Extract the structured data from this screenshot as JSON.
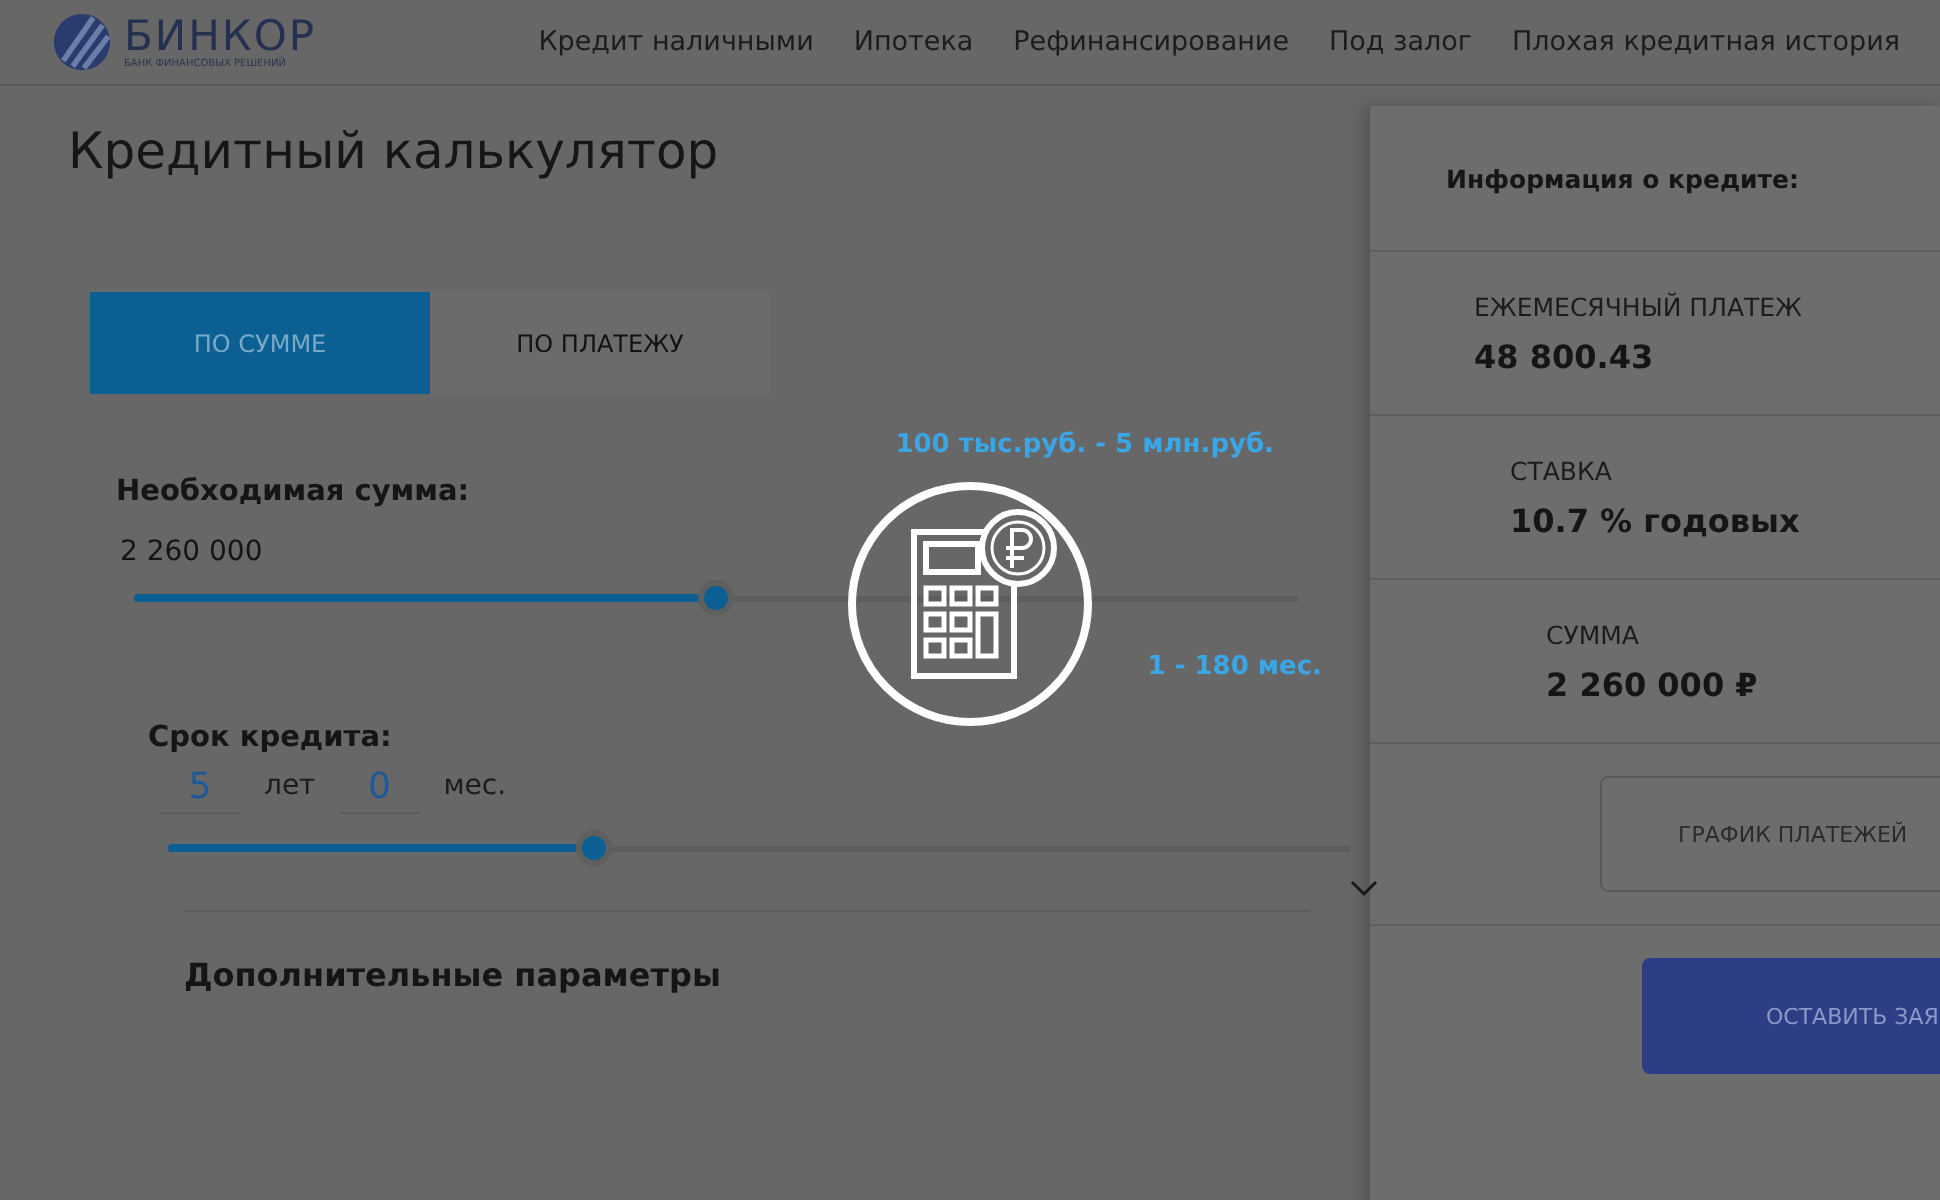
{
  "logo": {
    "name": "БИНКОР",
    "tagline": "БАНК ФИНАНСОВЫХ РЕШЕНИЙ"
  },
  "nav": [
    "Кредит наличными",
    "Ипотека",
    "Рефинансирование",
    "Под залог",
    "Плохая кредитная история"
  ],
  "calculator": {
    "title": "Кредитный калькулятор",
    "tabs": [
      {
        "label": "ПО СУММЕ",
        "selected": true
      },
      {
        "label": "ПО ПЛАТЕЖУ",
        "selected": false
      }
    ],
    "amount": {
      "range": "100 тыс.руб. - 5 млн.руб.",
      "label": "Необходимая сумма:",
      "value": "2 260 000",
      "level": 0.5
    },
    "term": {
      "range": "1 - 180 мес.",
      "label": "Срок кредита:",
      "years": "5",
      "years_unit": "лет",
      "months": "0",
      "months_unit": "мес.",
      "level": 0.36
    },
    "extra": {
      "label": "Дополнительные параметры",
      "expanded": false
    }
  },
  "summary": {
    "title": "Информация о кредите:",
    "items": [
      {
        "label": "ЕЖЕМЕСЯЧНЫЙ ПЛАТЕЖ",
        "value": "48 800.43"
      },
      {
        "label": "СТАВКА",
        "value": "10.7 % годовых"
      },
      {
        "label": "СУММА",
        "value": "2 260 000 ₽"
      }
    ],
    "buttons": [
      {
        "label": "ГРАФИК ПЛАТЕЖЕЙ",
        "kind": "outline"
      },
      {
        "label": "ОСТАВИТЬ ЗАЯ",
        "kind": "primary"
      }
    ]
  }
}
